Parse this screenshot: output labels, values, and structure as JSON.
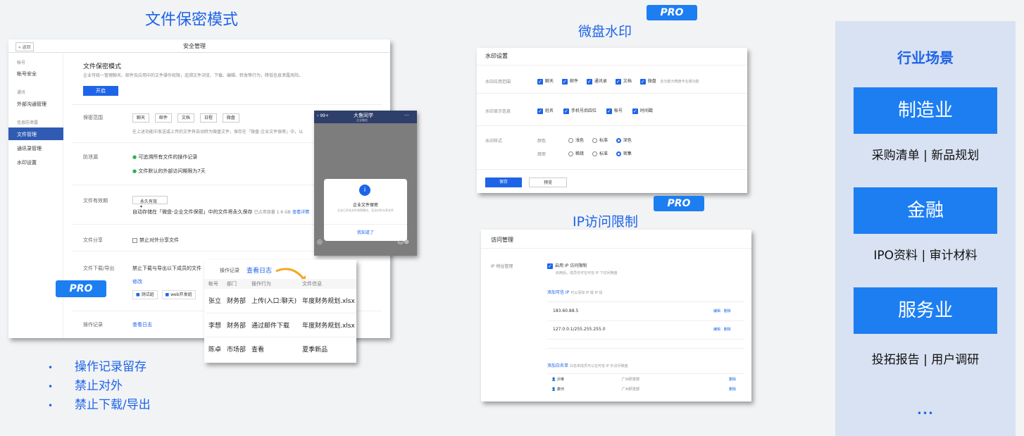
{
  "sections": {
    "file_mode_title": "文件保密模式",
    "watermark_title": "微盘水印",
    "ip_title": "IP访问限制",
    "pro": "PRO"
  },
  "bullets": [
    "操作记录留存",
    "禁止对外",
    "禁止下载/导出"
  ],
  "admin": {
    "back": "« 返回",
    "header": "安全管理",
    "nav_groups": [
      {
        "heading": "帐号",
        "items": [
          "帐号安全"
        ]
      },
      {
        "heading": "通讯",
        "items": [
          "外部沟通管理"
        ]
      },
      {
        "heading": "信息防泄露",
        "items": [
          "文件管理",
          "通讯录管理",
          "水印设置"
        ]
      }
    ],
    "active_item": "文件管理",
    "title": "文件保密模式",
    "desc": "企业可统一管理聊天、邮件及应用中的文件操作权限，追溯文件浏览、下载、编辑、转发等行为，降低信息泄露风险。",
    "enable_btn": "开启",
    "scope_label": "保密范围",
    "scope_chips": [
      "聊天",
      "邮件",
      "文档",
      "日程",
      "微盘"
    ],
    "scope_note": "在上述功能中发送或上传的文件将自动转为微盘文件，保存在「微盘-企业文件保密」中，以",
    "leak_label": "防泄漏",
    "leak_items": [
      "可追溯所有文件的操作记录",
      "文件默认的外部访问期限为7天"
    ],
    "validity_label": "文件有效期",
    "validity_select": "永久有效",
    "validity_note": "自动存储在「微盘-企业文件保密」中的文件将永久保存",
    "validity_usage": "已占用容量 1.6 GB",
    "validity_link": "查看详情",
    "share_label": "文件分享",
    "share_option": "禁止对外分享文件",
    "download_label": "文件下载/导出",
    "download_text": "禁止下载与导出以下成员的文件",
    "download_modify": "修改",
    "download_groups": [
      "测试组",
      "web开发组"
    ],
    "log_label": "操作记录",
    "log_link": "查看日志"
  },
  "phone": {
    "back": "99+",
    "title": "大鲁同学",
    "subtitle": "企业微信",
    "dialog_title": "企业文件保密",
    "dialog_text": "企业已开启文件保密模式，无法对外分享文件",
    "dialog_btn": "我知道了"
  },
  "oplog": {
    "tab": "操作记录",
    "link": "查看日志",
    "headers": [
      "帐号",
      "部门",
      "操作行为",
      "文件信息"
    ],
    "rows": [
      [
        "张立",
        "财务部",
        "上传(入口:聊天)",
        "年度财务规划.xlsx"
      ],
      [
        "李想",
        "财务部",
        "通过邮件下载",
        "年度财务规划.xlsx"
      ],
      [
        "陈卓",
        "市场部",
        "查看",
        "夏季新品"
      ]
    ]
  },
  "watermark": {
    "header": "水印设置",
    "scope_label": "水印应用范围",
    "scope_items": [
      "聊天",
      "邮件",
      "通讯录",
      "文档",
      "微盘"
    ],
    "scope_note": "此功能为微盘专业版功能",
    "info_label": "水印显示信息",
    "info_items": [
      "姓名",
      "手机号后四位",
      "帐号",
      "时间戳"
    ],
    "style_label": "水印样式",
    "color_label": "颜色",
    "color_options": [
      "浅色",
      "标准",
      "深色"
    ],
    "density_label": "疏密",
    "density_options": [
      "稀疏",
      "标准",
      "密集"
    ],
    "save_btn": "保存",
    "preview_btn": "预览"
  },
  "ip": {
    "header": "访问管理",
    "label": "IP 地址管理",
    "enable": "启用 IP 访问限制",
    "enable_note": "启用后，成员仅可在可信 IP 下访问微盘",
    "trusted_link": "添加可信 IP",
    "trusted_note": "可以添加 IP 或 IP 段",
    "trusted_rows": [
      "183.60.88.5",
      "127.0.0.1/255.255.255.0"
    ],
    "row_actions": "编辑 · 删除",
    "white_link": "添加白名单",
    "white_note": "白名单成员可以在可信 IP 外访问微盘",
    "white_rows": [
      {
        "name": "沂琳",
        "dept": "广州研发部",
        "action": "删除"
      },
      {
        "name": "康河",
        "dept": "广州研发部",
        "action": "删除"
      }
    ]
  },
  "industry": {
    "title": "行业场景",
    "items": [
      {
        "name": "制造业",
        "desc": "采购清单 | 新品规划"
      },
      {
        "name": "金融",
        "desc": "IPO资料 | 审计材料"
      },
      {
        "name": "服务业",
        "desc": "投拓报告 | 用户调研"
      }
    ],
    "more": "•••"
  }
}
